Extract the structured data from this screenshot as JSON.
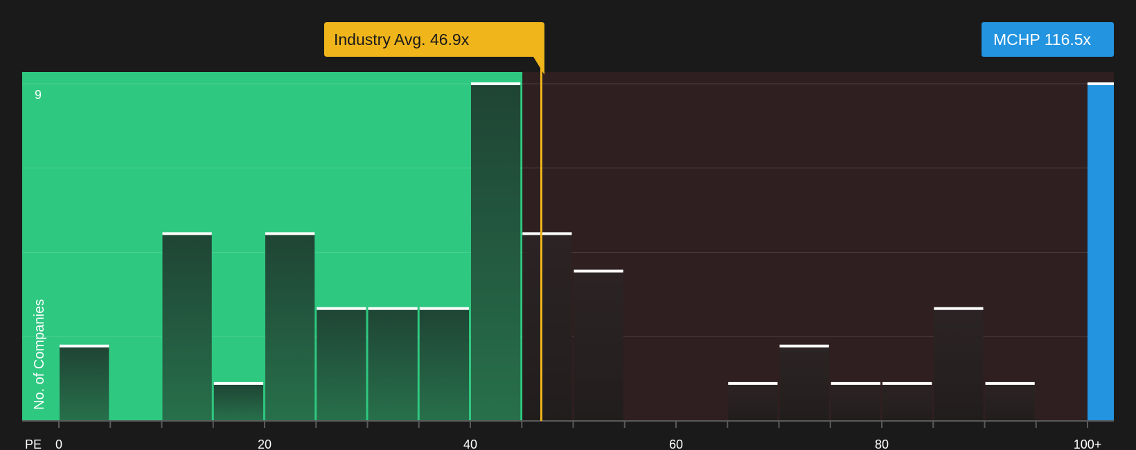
{
  "chart_data": {
    "type": "bar",
    "xlabel": "PE",
    "ylabel": "No. of Companies",
    "x_ticks": [
      "0",
      "20",
      "40",
      "60",
      "80",
      "100+"
    ],
    "y_ticks": [
      "9"
    ],
    "ylim": [
      0,
      9
    ],
    "bin_width": 5,
    "bars": [
      {
        "x": 0,
        "value": 2
      },
      {
        "x": 5,
        "value": 0
      },
      {
        "x": 10,
        "value": 5
      },
      {
        "x": 15,
        "value": 1
      },
      {
        "x": 20,
        "value": 5
      },
      {
        "x": 25,
        "value": 3
      },
      {
        "x": 30,
        "value": 3
      },
      {
        "x": 35,
        "value": 3
      },
      {
        "x": 40,
        "value": 9
      },
      {
        "x": 45,
        "value": 5
      },
      {
        "x": 50,
        "value": 4
      },
      {
        "x": 55,
        "value": 0
      },
      {
        "x": 60,
        "value": 0
      },
      {
        "x": 65,
        "value": 1
      },
      {
        "x": 70,
        "value": 2
      },
      {
        "x": 75,
        "value": 1
      },
      {
        "x": 80,
        "value": 1
      },
      {
        "x": 85,
        "value": 3
      },
      {
        "x": 90,
        "value": 1
      },
      {
        "x": 95,
        "value": 0
      }
    ],
    "highlight_bar": {
      "label": "MCHP 116.5x",
      "value": 9,
      "color": "#2394e0"
    },
    "industry_avg": {
      "label": "Industry Avg. 46.9x",
      "x": 46.9,
      "color": "#f0b51b"
    },
    "region_split": 45,
    "colors": {
      "below_region": "#2ec880",
      "above_region": "#2f1f20",
      "bar_below": "#22523a",
      "bar_above": "#2a2222",
      "bar_cap": "#ffffff",
      "background": "#1a1a1a"
    }
  }
}
